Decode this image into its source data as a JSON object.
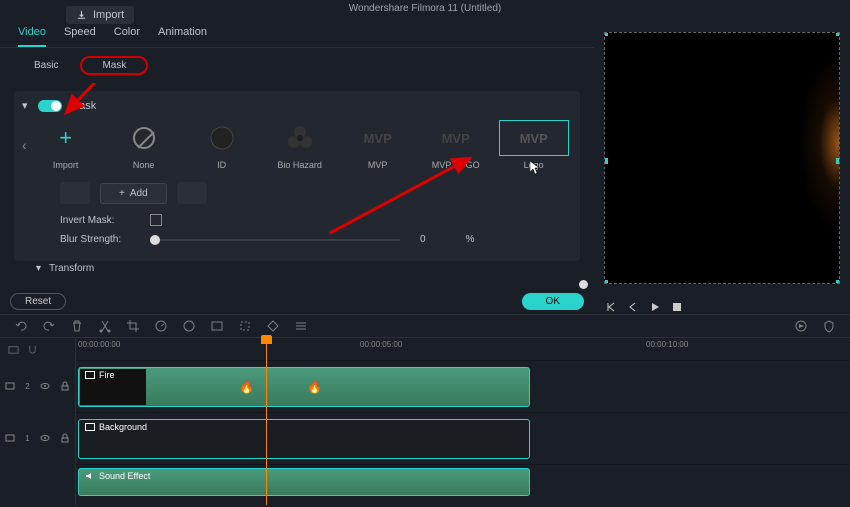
{
  "app": {
    "title": "Wondershare Filmora 11 (Untitled)",
    "import_label": "Import"
  },
  "tabs": {
    "video": "Video",
    "speed": "Speed",
    "color": "Color",
    "animation": "Animation"
  },
  "subtabs": {
    "basic": "Basic",
    "mask": "Mask"
  },
  "mask": {
    "section_label": "Mask",
    "items": {
      "import": "Import",
      "none": "None",
      "id": "ID",
      "biohazard": "Bio Hazard",
      "mvp": "MVP",
      "mvplogo": "MVP LOGO",
      "logo": "Logo"
    },
    "add_label": "Add",
    "invert_label": "Invert Mask:",
    "blur_label": "Blur Strength:",
    "blur_value": "0",
    "blur_unit": "%",
    "transform_label": "Transform"
  },
  "buttons": {
    "reset": "Reset",
    "ok": "OK"
  },
  "timeline": {
    "ruler": {
      "t0": "00:00:00:00",
      "t1": "00:00:05:00",
      "t2": "00:00:10:00"
    },
    "tracks": {
      "t2": "2",
      "t1": "1"
    },
    "clips": {
      "fire": "Fire",
      "background": "Background",
      "sound": "Sound Effect"
    }
  },
  "icons": {
    "mvp_text": "MVP"
  }
}
